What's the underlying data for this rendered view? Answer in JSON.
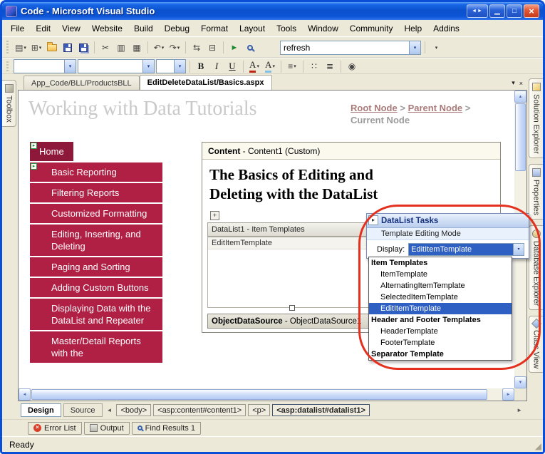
{
  "window": {
    "title": "Code - Microsoft Visual Studio",
    "status": "Ready"
  },
  "menu": {
    "items": [
      "File",
      "Edit",
      "View",
      "Website",
      "Build",
      "Debug",
      "Format",
      "Layout",
      "Tools",
      "Window",
      "Community",
      "Help",
      "Addins"
    ]
  },
  "toolbar": {
    "search_value": "refresh"
  },
  "format_toolbar": {
    "bold": "B",
    "italic": "I",
    "underline": "U"
  },
  "doc_tabs": {
    "tab1": "App_Code/BLL/ProductsBLL",
    "tab2": "EditDeleteDataList/Basics.aspx"
  },
  "side": {
    "left": "Toolbox",
    "right": [
      "Solution Explorer",
      "Properties",
      "Database Explorer",
      "Class View"
    ]
  },
  "designer": {
    "page_title": "Working with Data Tutorials",
    "breadcrumb": {
      "root": "Root Node",
      "sep": ">",
      "parent": "Parent Node",
      "current": "Current Node"
    },
    "nav": {
      "items": [
        "Home",
        "Basic Reporting",
        "Filtering Reports",
        "Customized Formatting",
        "Editing, Inserting, and Deleting",
        "Paging and Sorting",
        "Adding Custom Buttons",
        "Displaying Data with the DataList and Repeater",
        "Master/Detail Reports with the"
      ]
    },
    "content": {
      "header_bold": "Content",
      "header_rest": " - Content1 (Custom)",
      "heading_line1": "The Basics of Editing and",
      "heading_line2": "Deleting with the DataList",
      "datalist_header": "DataList1 - Item Templates",
      "template_label": "EditItemTemplate",
      "ods_bold": "ObjectDataSource",
      "ods_rest": " - ObjectDataSource1"
    },
    "smart_panel": {
      "title": "DataList Tasks",
      "subtitle": "Template Editing Mode",
      "display_label": "Display:",
      "display_value": "EditItemTemplate",
      "dropdown": [
        {
          "label": "Item Templates",
          "kind": "header"
        },
        {
          "label": "ItemTemplate",
          "kind": "item"
        },
        {
          "label": "AlternatingItemTemplate",
          "kind": "item"
        },
        {
          "label": "SelectedItemTemplate",
          "kind": "item"
        },
        {
          "label": "EditItemTemplate",
          "kind": "item",
          "selected": true
        },
        {
          "label": "Header and Footer Templates",
          "kind": "header"
        },
        {
          "label": "HeaderTemplate",
          "kind": "item"
        },
        {
          "label": "FooterTemplate",
          "kind": "item"
        },
        {
          "label": "Separator Template",
          "kind": "header"
        }
      ]
    }
  },
  "bottom": {
    "view_tabs": [
      "Design",
      "Source"
    ],
    "tag_path": [
      "<body>",
      "<asp:content#content1>",
      "<p>",
      "<asp:datalist#datalist1>"
    ],
    "panel_tabs": [
      "Error List",
      "Output",
      "Find Results 1"
    ]
  },
  "icons": {
    "window_shrink": "◄►",
    "minimize": "▁",
    "restore": "□",
    "close": "×",
    "new_document": "▤",
    "add_item": "⊞",
    "cut": "✂",
    "copy": "▥",
    "paste": "▦",
    "undo": "↶",
    "redo": "↷",
    "navigate_back": "⇆",
    "comment": "⊟",
    "start_debug": "►",
    "dropdown": "▾",
    "font_color": "A",
    "highlight": "A",
    "align": "≡",
    "bullets": "∷",
    "numbering": "≣",
    "hyperlink": "◉",
    "tab_dropdown": "▾",
    "tab_close": "×",
    "smart_tag": "▸",
    "move_handle": "+",
    "nav_arrow": "▸",
    "scroll_up": "▲",
    "scroll_down": "▼",
    "scroll_left": "◄",
    "scroll_right": "►",
    "chev_left": "◄",
    "chev_right": "►",
    "resize_grip": "◢"
  },
  "colors": {
    "titlebar_blue": "#0B51CE",
    "nav_red": "#B01F44",
    "nav_dark_red": "#8E1839",
    "selection_blue": "#2E5FC2",
    "annotation_red": "#E3301F",
    "window_chrome": "#ECE9D8"
  }
}
